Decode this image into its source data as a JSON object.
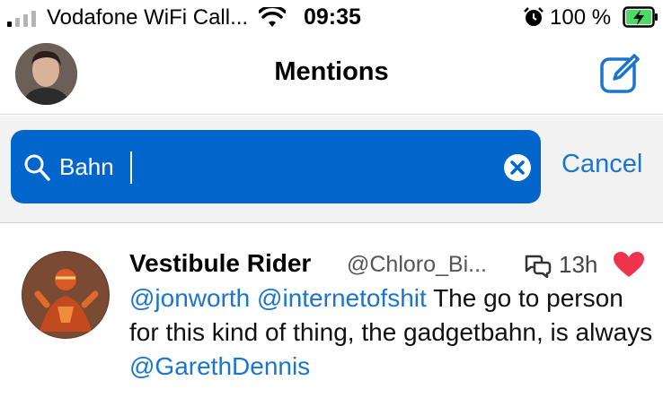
{
  "status_bar": {
    "carrier": "Vodafone WiFi Call...",
    "time": "09:35",
    "battery_percent": "100 %",
    "icons": [
      "signal-icon",
      "wifi-icon",
      "alarm-icon",
      "battery-charging-icon"
    ]
  },
  "nav": {
    "title": "Mentions",
    "avatar_icon": "profile-avatar",
    "compose_icon": "compose-icon"
  },
  "search": {
    "value": "Bahn",
    "cancel_label": "Cancel",
    "colors": {
      "field": "#0066cc",
      "accent": "#1a75cf"
    }
  },
  "tweet": {
    "display_name": "Vestibule Rider",
    "handle": "@Chloro_Bi...",
    "time": "13h",
    "liked": true,
    "mention_1": "@jonworth",
    "mention_2": "@internetofshit",
    "text_1": " The go to person for this kind of thing, the gadgetbahn, is always ",
    "mention_3": "@GarethDennis",
    "colors": {
      "heart": "#f0334d",
      "link": "#1a75cf"
    }
  }
}
